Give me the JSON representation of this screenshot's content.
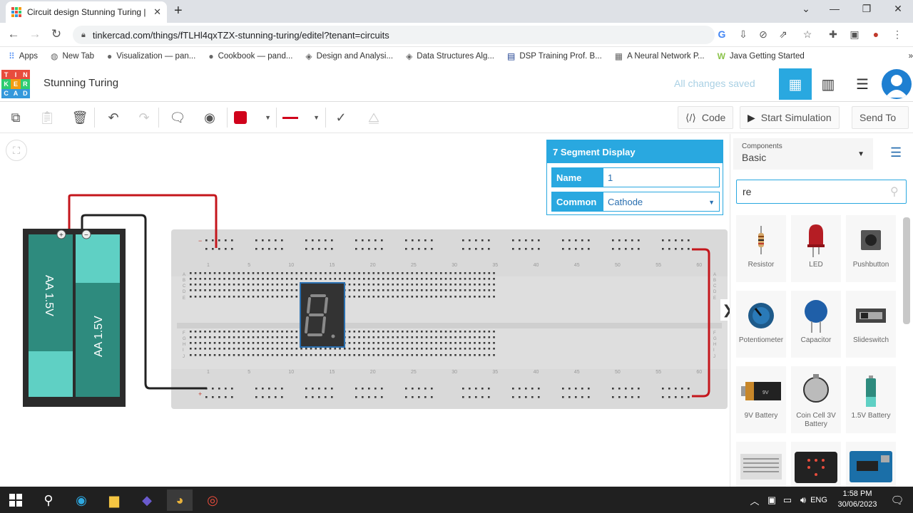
{
  "browser": {
    "tab_title": "Circuit design Stunning Turing | Ti",
    "url": "tinkercad.com/things/fTLHl4qxTZX-stunning-turing/editel?tenant=circuits",
    "bookmarks": [
      {
        "label": "Apps",
        "icon": "apps-grid-icon"
      },
      {
        "label": "New Tab",
        "icon": "globe-icon"
      },
      {
        "label": "Visualization — pan...",
        "icon": "github-icon"
      },
      {
        "label": "Cookbook — pand...",
        "icon": "github-icon"
      },
      {
        "label": "Design and Analysi...",
        "icon": "diamond-icon"
      },
      {
        "label": "Data Structures Alg...",
        "icon": "diamond-icon"
      },
      {
        "label": "DSP Training Prof. B...",
        "icon": "document-icon"
      },
      {
        "label": "A Neural Network P...",
        "icon": "image-icon"
      },
      {
        "label": "Java Getting Started",
        "icon": "w-icon"
      }
    ]
  },
  "app": {
    "title": "Stunning Turing",
    "save_status": "All changes saved",
    "logo_letters": [
      "TIN",
      "KER",
      "CAD"
    ]
  },
  "toolbar": {
    "code_label": "Code",
    "simulate_label": "Start Simulation",
    "send_label": "Send To",
    "fill_color": "#d0021b"
  },
  "inspector": {
    "title": "7 Segment Display",
    "name_label": "Name",
    "name_value": "1",
    "common_label": "Common",
    "common_value": "Cathode"
  },
  "battery": {
    "cell1": "AA 1.5V",
    "cell2": "AA 1.5V",
    "plus": "+",
    "minus": "−"
  },
  "breadboard": {
    "column_labels": [
      "1",
      "5",
      "10",
      "15",
      "20",
      "25",
      "30",
      "35",
      "40",
      "45",
      "50",
      "55",
      "60"
    ],
    "row_labels_top": [
      "A",
      "B",
      "C",
      "D",
      "E"
    ],
    "row_labels_bottom": [
      "F",
      "G",
      "H",
      "I",
      "J"
    ]
  },
  "panel": {
    "components_label": "Components",
    "components_value": "Basic",
    "search_value": "re",
    "items": [
      {
        "name": "Resistor"
      },
      {
        "name": "LED"
      },
      {
        "name": "Pushbutton"
      },
      {
        "name": "Potentiometer"
      },
      {
        "name": "Capacitor"
      },
      {
        "name": "Slideswitch"
      },
      {
        "name": "9V Battery"
      },
      {
        "name": "Coin Cell 3V Battery"
      },
      {
        "name": "1.5V Battery"
      }
    ]
  },
  "taskbar": {
    "time": "1:58 PM",
    "date": "30/06/2023",
    "lang": "ENG"
  }
}
